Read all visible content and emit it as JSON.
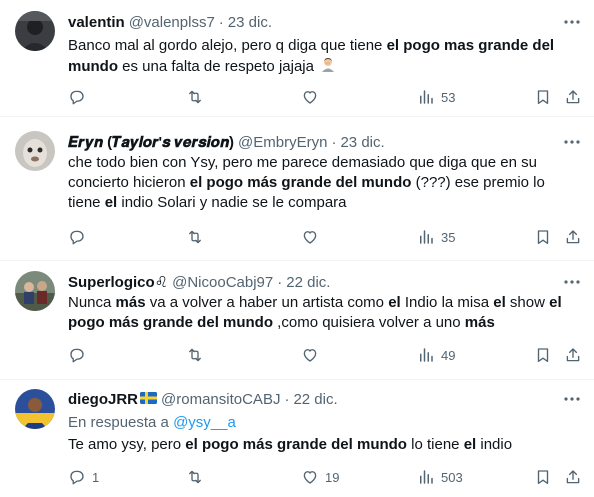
{
  "tweets": [
    {
      "name": "valentin",
      "handle": "@valenplss7",
      "sep": "·",
      "time": "23 dic.",
      "text_parts": [
        "Banco mal al gordo alejo, pero q diga que tiene ",
        "el pogo mas grande del mundo",
        " es una falta de respeto jajaja"
      ],
      "reply": "",
      "retweet": "",
      "like": "",
      "views": "53"
    },
    {
      "name": "𝑬𝒓𝒚𝒏 (𝑻𝒂𝒚𝒍𝒐𝒓'𝒔 𝒗𝒆𝒓𝒔𝒊𝒐𝒏)",
      "handle": "@EmbryEryn",
      "sep": "·",
      "time": "23 dic.",
      "text_parts": [
        "che todo bien con Ysy, pero me parece demasiado que diga que en su concierto hicieron ",
        "el pogo más grande del mundo",
        " (???) ese premio lo tiene ",
        "el",
        " indio Solari y nadie se le compara"
      ],
      "reply": "",
      "retweet": "",
      "like": "",
      "views": "35"
    },
    {
      "name": "Superlogico♌",
      "handle": "@NicooCabj97",
      "sep": "·",
      "time": "22 dic.",
      "text_parts": [
        "Nunca ",
        "más",
        " va a volver a haber un artista como ",
        "el",
        " Indio la misa ",
        "el",
        " show ",
        "el pogo más grande del mundo",
        " ,como quisiera volver a uno ",
        "más"
      ],
      "reply": "",
      "retweet": "",
      "like": "",
      "views": "49"
    },
    {
      "name": "diegoJRR",
      "handle": "@romansitoCABJ",
      "sep": "·",
      "time": "22 dic.",
      "reply_prefix": "En respuesta a ",
      "reply_to": "@ysy__a",
      "text_parts": [
        "Te amo ysy, pero ",
        "el pogo más grande del mundo",
        " lo tiene ",
        "el",
        " indio"
      ],
      "reply": "1",
      "retweet": "",
      "like": "19",
      "views": "503"
    }
  ],
  "colors": {
    "text": "#0f1419",
    "secondary": "#536471",
    "link": "#1d9bf0",
    "divider": "#eff3f4"
  },
  "icons": [
    "more-icon",
    "reply-icon",
    "retweet-icon",
    "like-icon",
    "views-icon",
    "bookmark-icon",
    "share-icon",
    "facepalm-emoji",
    "sweden-flag-emoji"
  ]
}
